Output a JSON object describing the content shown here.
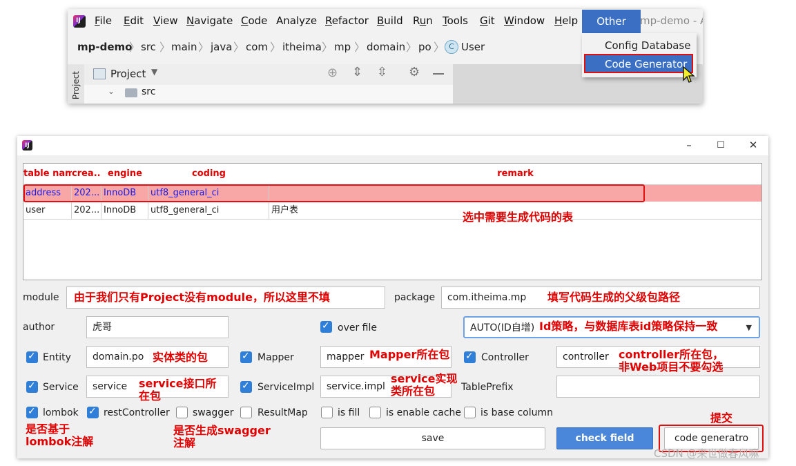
{
  "ide": {
    "menu": [
      "File",
      "Edit",
      "View",
      "Navigate",
      "Code",
      "Analyze",
      "Refactor",
      "Build",
      "Run",
      "Tools",
      "Git",
      "Window",
      "Help"
    ],
    "menu_mnemonic": [
      "F",
      "E",
      "V",
      "N",
      "C",
      "",
      "R",
      "B",
      "R",
      "T",
      "G",
      "W",
      "H"
    ],
    "active_menu": "Other",
    "window_title": "mp-demo - A",
    "breadcrumb": [
      "mp-demo",
      "src",
      "main",
      "java",
      "com",
      "itheima",
      "mp",
      "domain",
      "po"
    ],
    "breadcrumb_file": "User",
    "file_icon_letter": "C",
    "tool_window_label": "Project",
    "project_dropdown": "Project",
    "tree_item": "src",
    "dropdown": [
      "Config Database",
      "Code Generator"
    ],
    "highlighted_item": "Code Generator",
    "accent": "#3a6fc3"
  },
  "dialog": {
    "window_controls": {
      "minimize": "–",
      "maximize": "☐",
      "close": "✕"
    },
    "columns": [
      "table name",
      "crea...",
      "engine",
      "coding",
      "remark"
    ],
    "rows": [
      {
        "name": "address",
        "created": "202...",
        "engine": "InnoDB",
        "coding": "utf8_general_ci",
        "remark": ""
      },
      {
        "name": "user",
        "created": "202...",
        "engine": "InnoDB",
        "coding": "utf8_general_ci",
        "remark": "用户表"
      }
    ],
    "labels": {
      "module": "module",
      "package": "package",
      "author": "author",
      "over_file": "over file",
      "entity": "Entity",
      "mapper": "Mapper",
      "controller": "Controller",
      "service": "Service",
      "service_impl": "ServiceImpl",
      "table_prefix": "TablePrefix",
      "lombok": "lombok",
      "rest_controller": "restController",
      "swagger": "swagger",
      "result_map": "ResultMap",
      "is_fill": "is fill",
      "is_enable_cache": "is enable cache",
      "is_base_column": "is base column"
    },
    "values": {
      "module": "",
      "package": "com.itheima.mp",
      "author": "虎哥",
      "id_type": "AUTO(ID自增)",
      "entity": "domain.po",
      "mapper": "mapper",
      "controller": "controller",
      "service": "service",
      "service_impl": "service.impl",
      "table_prefix": ""
    },
    "checks": {
      "over_file": true,
      "entity": true,
      "mapper": true,
      "controller": true,
      "service": true,
      "service_impl": true,
      "lombok": true,
      "rest_controller": true,
      "swagger": false,
      "result_map": false,
      "is_fill": false,
      "is_enable_cache": false,
      "is_base_column": false
    },
    "buttons": {
      "save": "save",
      "check_field": "check field",
      "code_generator": "code generatro"
    }
  },
  "annotations": {
    "select_table": "选中需要生成代码的表",
    "module": "由于我们只有Project没有module，所以这里不填",
    "package": "填写代码生成的父级包路径",
    "id_type": "Id策略，与数据库表id策略保持一致",
    "entity": "实体类的包",
    "mapper": "Mapper所在包",
    "controller_1": "controller所在包，",
    "controller_2": "非Web项目不要勾选",
    "service_1": "service接口所",
    "service_2": "在包",
    "service_impl_1": "service实现",
    "service_impl_2": "类所在包",
    "lombok_1": "是否基于",
    "lombok_2": "lombok注解",
    "swagger_1": "是否生成swagger",
    "swagger_2": "注解",
    "submit": "提交",
    "color": "#e00000"
  },
  "watermark": "CSDN @来世做春风嘛"
}
